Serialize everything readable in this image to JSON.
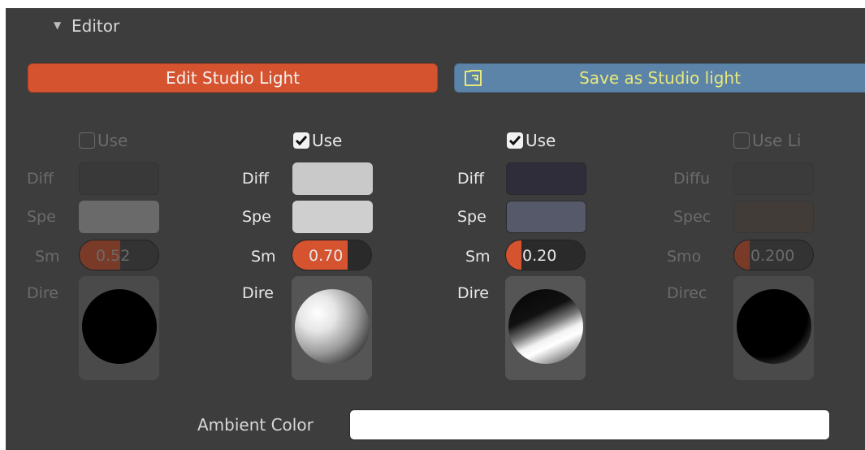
{
  "section": {
    "title": "Editor"
  },
  "buttons": {
    "edit_label": "Edit Studio Light",
    "save_label": "Save as Studio light"
  },
  "lights": [
    {
      "use_label": "Use",
      "use_checked": false,
      "diffuse_label": "Diff",
      "specular_label": "Spe",
      "smooth_label": "Sm",
      "smooth_value": "0.52",
      "smooth_fraction": 0.52,
      "direction_label": "Dire",
      "diffuse_color": "#393939",
      "specular_color": "#6a6a6a",
      "enabled": false
    },
    {
      "use_label": "Use",
      "use_checked": true,
      "diffuse_label": "Diff",
      "specular_label": "Spe",
      "smooth_label": "Sm",
      "smooth_value": "0.70",
      "smooth_fraction": 0.7,
      "direction_label": "Dire",
      "diffuse_color": "#c9c9c9",
      "specular_color": "#cfcfcf",
      "enabled": true
    },
    {
      "use_label": "Use",
      "use_checked": true,
      "diffuse_label": "Diff",
      "specular_label": "Spe",
      "smooth_label": "Sm",
      "smooth_value": "0.20",
      "smooth_fraction": 0.2,
      "direction_label": "Dire",
      "diffuse_color": "#2f2d3a",
      "specular_color": "#55596a",
      "enabled": true
    },
    {
      "use_label": "Use Li",
      "use_checked": false,
      "diffuse_label": "Diffu",
      "specular_label": "Spec",
      "smooth_label": "Smo",
      "smooth_value": "0.200",
      "smooth_fraction": 0.2,
      "direction_label": "Direc",
      "diffuse_color": "#3b3b3b",
      "specular_color": "#423c39",
      "enabled": false
    }
  ],
  "ambient": {
    "label": "Ambient Color",
    "color": "#ffffff"
  },
  "colors": {
    "accent": "#d6532f",
    "save_button": "#5c84a8",
    "panel_bg": "#3d3d3d"
  },
  "icons": {
    "expand": "triangle-down-icon",
    "save": "save-file-icon",
    "check": "checkmark-icon"
  }
}
